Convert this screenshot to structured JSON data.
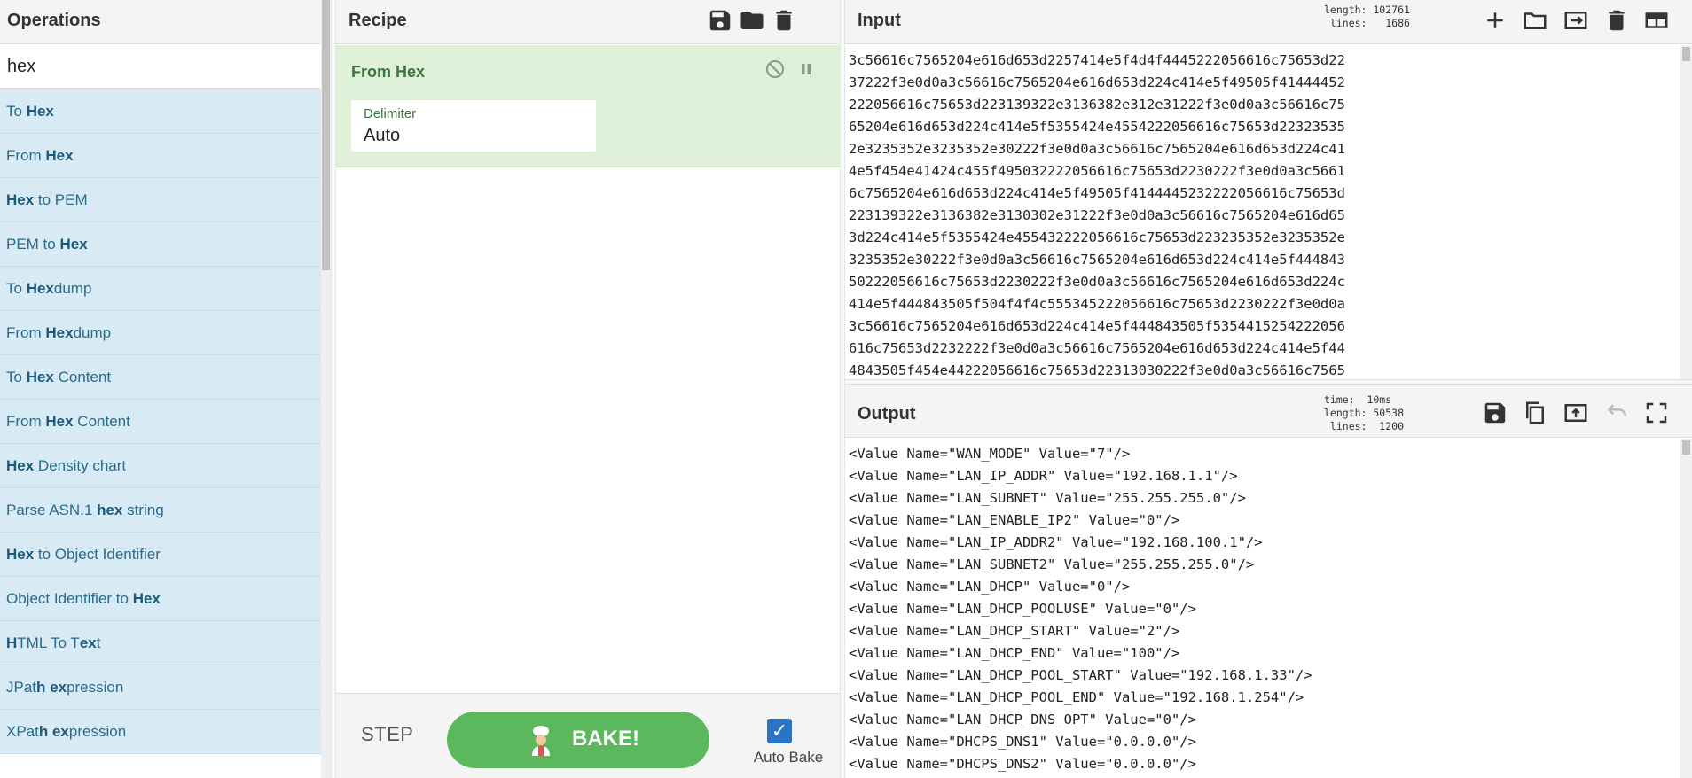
{
  "operations": {
    "title": "Operations",
    "search_value": "hex",
    "items": [
      {
        "pre": "To ",
        "match": "Hex",
        "post": ""
      },
      {
        "pre": "From ",
        "match": "Hex",
        "post": ""
      },
      {
        "pre": "",
        "match": "Hex",
        "post": " to PEM"
      },
      {
        "pre": "PEM to ",
        "match": "Hex",
        "post": ""
      },
      {
        "pre": "To ",
        "match": "Hex",
        "post": "dump"
      },
      {
        "pre": "From ",
        "match": "Hex",
        "post": "dump"
      },
      {
        "pre": "To ",
        "match": "Hex",
        "post": " Content"
      },
      {
        "pre": "From ",
        "match": "Hex",
        "post": " Content"
      },
      {
        "pre": "",
        "match": "Hex",
        "post": " Density chart"
      },
      {
        "pre": "Parse ASN.1 ",
        "match": "hex",
        "post": " string"
      },
      {
        "pre": "",
        "match": "Hex",
        "post": " to Object Identifier"
      },
      {
        "pre": "Object Identifier to ",
        "match": "Hex",
        "post": ""
      },
      {
        "rich": [
          [
            "H",
            true
          ],
          [
            "TML To T",
            false
          ],
          [
            "ex",
            true
          ],
          [
            "t",
            false
          ]
        ]
      },
      {
        "rich": [
          [
            "JPat",
            false
          ],
          [
            "h ex",
            true
          ],
          [
            "pression",
            false
          ]
        ]
      },
      {
        "rich": [
          [
            "XPat",
            false
          ],
          [
            "h ex",
            true
          ],
          [
            "pression",
            false
          ]
        ]
      }
    ]
  },
  "recipe": {
    "title": "Recipe",
    "operation": {
      "name": "From Hex",
      "ingredient_label": "Delimiter",
      "ingredient_value": "Auto"
    },
    "step_label": "STEP",
    "bake_label": "BAKE!",
    "auto_bake_label": "Auto Bake",
    "auto_bake_checked": true
  },
  "input": {
    "title": "Input",
    "stats": "length: 102761\n lines:   1686",
    "lines": [
      "3c56616c7565204e616d653d2257414e5f4d4f4445222056616c75653d22",
      "37222f3e0d0a3c56616c7565204e616d653d224c414e5f49505f41444452",
      "222056616c75653d223139322e3136382e312e31222f3e0d0a3c56616c75",
      "65204e616d653d224c414e5f5355424e4554222056616c75653d22323535",
      "2e3235352e3235352e30222f3e0d0a3c56616c7565204e616d653d224c41",
      "4e5f454e41424c455f495032222056616c75653d2230222f3e0d0a3c5661",
      "6c7565204e616d653d224c414e5f49505f4144445232222056616c75653d",
      "223139322e3136382e3130302e31222f3e0d0a3c56616c7565204e616d65",
      "3d224c414e5f5355424e455432222056616c75653d223235352e3235352e",
      "3235352e30222f3e0d0a3c56616c7565204e616d653d224c414e5f444843",
      "50222056616c75653d2230222f3e0d0a3c56616c7565204e616d653d224c",
      "414e5f444843505f504f4f4c555345222056616c75653d2230222f3e0d0a",
      "3c56616c7565204e616d653d224c414e5f444843505f5354415254222056",
      "616c75653d2232222f3e0d0a3c56616c7565204e616d653d224c414e5f44",
      "4843505f454e44222056616c75653d22313030222f3e0d0a3c56616c7565"
    ]
  },
  "output": {
    "title": "Output",
    "stats": "time:  10ms\nlength: 50538\n lines:  1200",
    "lines": [
      "<Value Name=\"WAN_MODE\" Value=\"7\"/>",
      "<Value Name=\"LAN_IP_ADDR\" Value=\"192.168.1.1\"/>",
      "<Value Name=\"LAN_SUBNET\" Value=\"255.255.255.0\"/>",
      "<Value Name=\"LAN_ENABLE_IP2\" Value=\"0\"/>",
      "<Value Name=\"LAN_IP_ADDR2\" Value=\"192.168.100.1\"/>",
      "<Value Name=\"LAN_SUBNET2\" Value=\"255.255.255.0\"/>",
      "<Value Name=\"LAN_DHCP\" Value=\"0\"/>",
      "<Value Name=\"LAN_DHCP_POOLUSE\" Value=\"0\"/>",
      "<Value Name=\"LAN_DHCP_START\" Value=\"2\"/>",
      "<Value Name=\"LAN_DHCP_END\" Value=\"100\"/>",
      "<Value Name=\"LAN_DHCP_POOL_START\" Value=\"192.168.1.33\"/>",
      "<Value Name=\"LAN_DHCP_POOL_END\" Value=\"192.168.1.254\"/>",
      "<Value Name=\"LAN_DHCP_DNS_OPT\" Value=\"0\"/>",
      "<Value Name=\"DHCPS_DNS1\" Value=\"0.0.0.0\"/>",
      "<Value Name=\"DHCPS_DNS2\" Value=\"0.0.0.0\"/>"
    ]
  },
  "colors": {
    "op_item_bg": "#d8eaf3",
    "recipe_op_bg": "#dff0d8",
    "bake_green": "#5cb85c",
    "checkbox_blue": "#2a74c5"
  },
  "icons": {
    "recipe_header": [
      "save-icon",
      "folder-icon",
      "trash-icon"
    ],
    "recipe_op": [
      "disable-icon",
      "pause-icon"
    ],
    "input_header": [
      "plus-icon",
      "folder-icon",
      "import-icon",
      "trash-icon",
      "layout-icon"
    ],
    "output_header": [
      "save-icon",
      "copy-icon",
      "move-to-input-icon",
      "undo-icon",
      "maximize-icon"
    ]
  }
}
